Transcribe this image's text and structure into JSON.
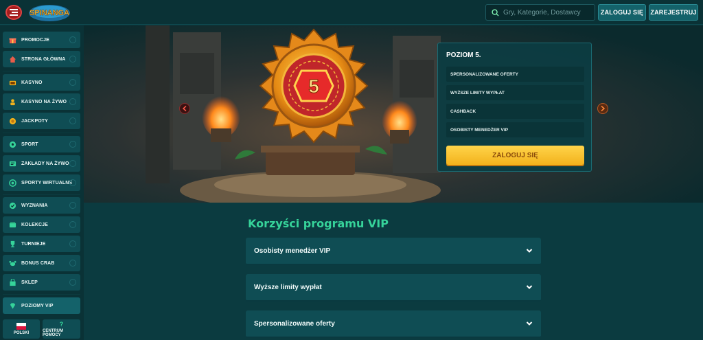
{
  "header": {
    "logo_text": "SPINANGA",
    "search_placeholder": "Gry, Kategorie, Dostawcy",
    "login_label": "ZALOGUJ SIĘ",
    "register_label": "ZAREJESTRUJ"
  },
  "sidebar": {
    "items": [
      {
        "label": "PROMOCJE",
        "icon": "gift-icon"
      },
      {
        "label": "STRONA GŁÓWNA",
        "icon": "home-icon"
      },
      {
        "label": "KASYNO",
        "icon": "slot-icon"
      },
      {
        "label": "KASYNO NA ŻYWO",
        "icon": "dealer-icon"
      },
      {
        "label": "JACKPOTY",
        "icon": "jackpot-icon"
      },
      {
        "label": "SPORT",
        "icon": "soccer-icon"
      },
      {
        "label": "ZAKŁADY NA ŻYWO",
        "icon": "live-bet-icon"
      },
      {
        "label": "SPORTY WIRTUALNE",
        "icon": "virtual-icon"
      },
      {
        "label": "WYZNANIA",
        "icon": "challenge-icon"
      },
      {
        "label": "KOLEKCJE",
        "icon": "collection-icon"
      },
      {
        "label": "TURNIEJE",
        "icon": "trophy-icon"
      },
      {
        "label": "BONUS CRAB",
        "icon": "crab-icon"
      },
      {
        "label": "SKLEP",
        "icon": "shop-icon"
      },
      {
        "label": "POZIOMY VIP",
        "icon": "diamond-icon"
      }
    ],
    "language_label": "POLSKI",
    "help_label": "CENTRUM POMOCY"
  },
  "level_card": {
    "title": "POZIOM 5.",
    "perks": [
      "SPERSONALIZOWANE OFERTY",
      "WYŻSZE LIMITY WYPŁAT",
      "CASHBACK",
      "OSOBISTY MENEDŻER VIP"
    ],
    "login_label": "ZALOGUJ SIĘ"
  },
  "hero": {
    "badge_number": "5"
  },
  "benefits": {
    "title": "Korzyści programu VIP",
    "items": [
      "Osobisty menedżer VIP",
      "Wyższe limity wypłat",
      "Spersonalizowane oferty"
    ]
  },
  "colors": {
    "accent_green": "#36d39a",
    "button_yellow": "#ffd44a",
    "header_bg": "#0a3236",
    "panel": "#0f4d54"
  }
}
